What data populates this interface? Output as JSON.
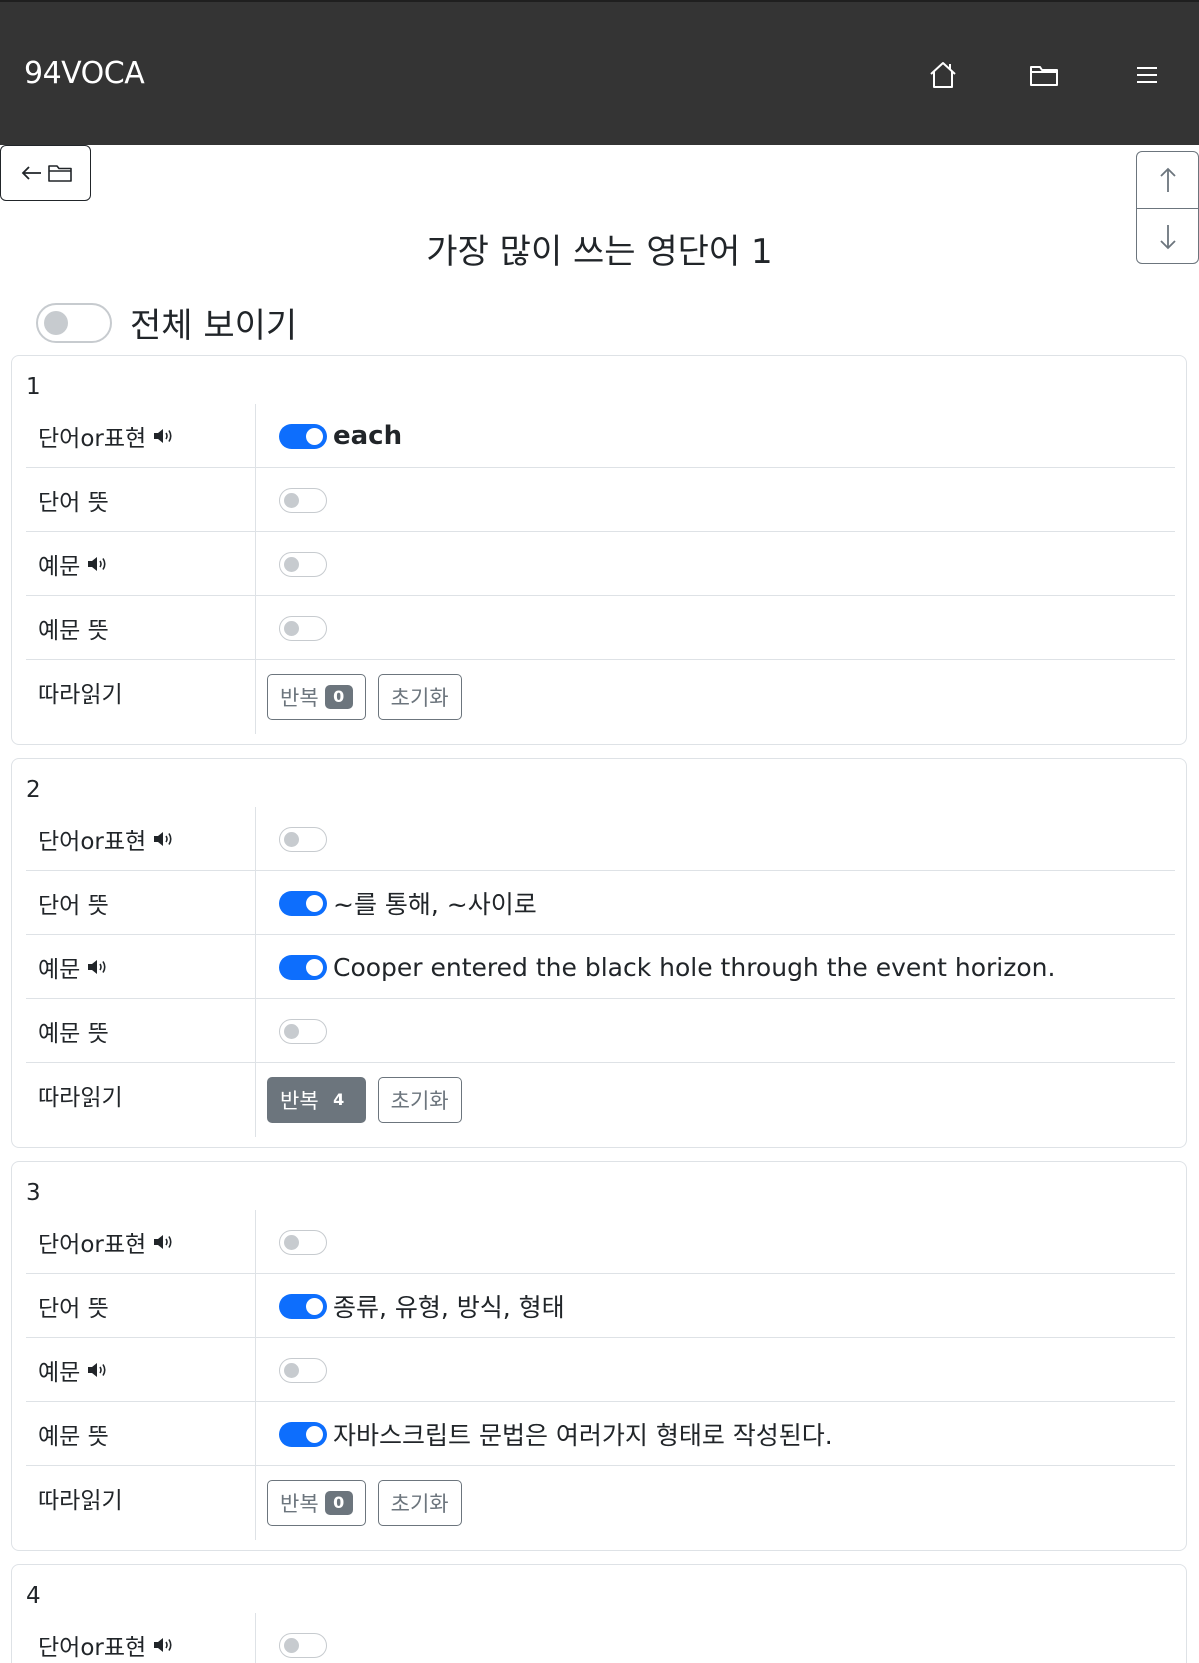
{
  "navbar": {
    "brand": "94VOCA",
    "icons": [
      "home-icon",
      "folder-icon",
      "menu-icon"
    ]
  },
  "back_button": {
    "icons": [
      "arrow-left-icon",
      "folder-icon"
    ]
  },
  "scroll_buttons": {
    "icons": [
      "arrow-up-icon",
      "arrow-down-icon"
    ]
  },
  "page": {
    "title": "가장 많이 쓰는 영단어 1",
    "show_all_label": "전체 보이기",
    "show_all_on": false
  },
  "labels": {
    "word": "단어or표현",
    "word_meaning": "단어 뜻",
    "example": "예문",
    "example_meaning": "예문 뜻",
    "shadowing": "따라읽기",
    "repeat": "반복",
    "reset": "초기화"
  },
  "colors": {
    "accent": "#0d6efd",
    "navbar": "#343434",
    "secondary": "#6c757d"
  },
  "cards": [
    {
      "number": "1",
      "word": {
        "on": true,
        "text": "each"
      },
      "word_meaning": {
        "on": false,
        "text": ""
      },
      "example": {
        "on": false,
        "text": ""
      },
      "example_meaning": {
        "on": false,
        "text": ""
      },
      "repeat_count": "0",
      "repeat_active": false
    },
    {
      "number": "2",
      "word": {
        "on": false,
        "text": ""
      },
      "word_meaning": {
        "on": true,
        "text": "~를 통해, ~사이로"
      },
      "example": {
        "on": true,
        "text": "Cooper entered the black hole through the event horizon."
      },
      "example_meaning": {
        "on": false,
        "text": ""
      },
      "repeat_count": "4",
      "repeat_active": true
    },
    {
      "number": "3",
      "word": {
        "on": false,
        "text": ""
      },
      "word_meaning": {
        "on": true,
        "text": "종류, 유형, 방식, 형태"
      },
      "example": {
        "on": false,
        "text": ""
      },
      "example_meaning": {
        "on": true,
        "text": "자바스크립트 문법은 여러가지 형태로 작성된다."
      },
      "repeat_count": "0",
      "repeat_active": false
    },
    {
      "number": "4",
      "word": {
        "on": false,
        "text": ""
      }
    }
  ]
}
